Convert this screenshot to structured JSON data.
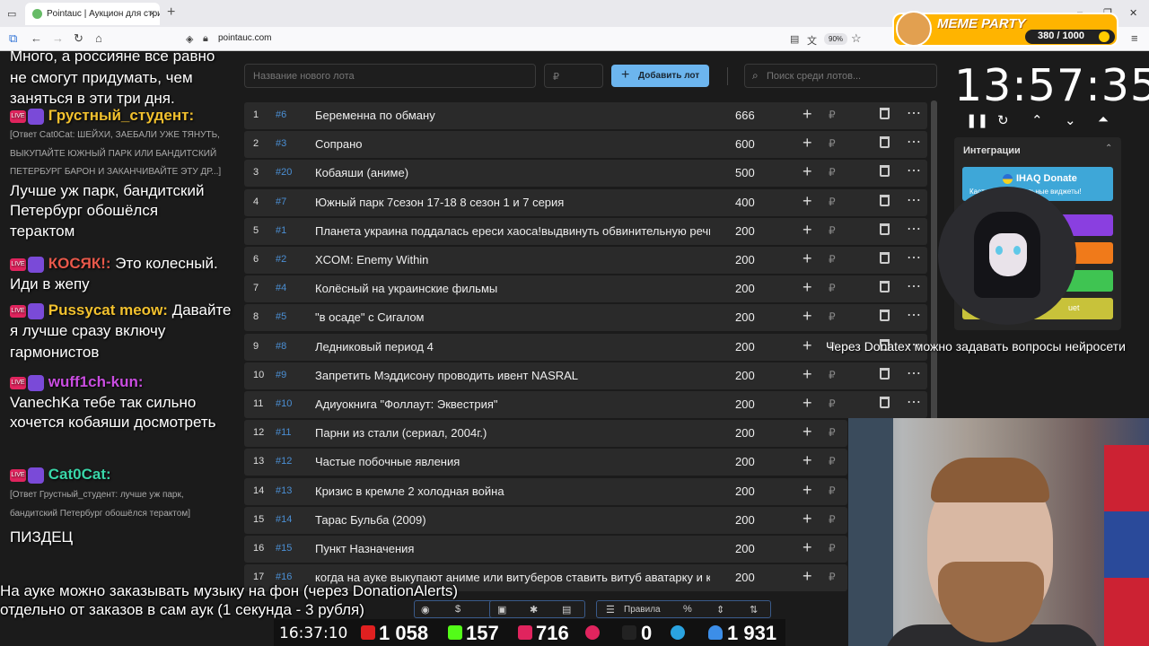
{
  "browser": {
    "tab_title": "Pointauc | Аукцион для стримеров",
    "url": "pointauc.com",
    "zoom": "90%"
  },
  "meme_party": {
    "title": "MEME PARTY",
    "count": "380 / 1000"
  },
  "chat": {
    "lines": [
      {
        "text": "Много, а россияне все равно"
      },
      {
        "text": "не смогут придумать, чем"
      },
      {
        "text": "заняться в эти три дня."
      },
      {
        "user": "Грустный_студент:",
        "color": "#f2c12e"
      },
      {
        "reply": "[Ответ Cat0Cat: ШЕЙХИ, ЗАЕБАЛИ УЖЕ ТЯНУТЬ,"
      },
      {
        "reply": "ВЫКУПАЙТЕ ЮЖНЫЙ ПАРК ИЛИ БАНДИТСКИЙ"
      },
      {
        "reply": "ПЕТЕРБУРГ БАРОН И ЗАКАНЧИВАЙТЕ ЭТУ ДР...]"
      },
      {
        "text": "Лучше уж парк, бандитский"
      },
      {
        "text": "Петербург обошёлся"
      },
      {
        "text": "терактом"
      },
      {
        "user": "КОСЯК!:",
        "color": "#e8584a",
        "msg": "Это колесный."
      },
      {
        "text": "Иди в жепу"
      },
      {
        "user": "Pussycat meow:",
        "color": "#f2c12e",
        "msg": "Давайте"
      },
      {
        "text": "я лучше сразу включу"
      },
      {
        "text": "гармонистов"
      },
      {
        "user": "wuff1ch-kun:",
        "color": "#c94de0"
      },
      {
        "text": "VanechKa тебе так сильно"
      },
      {
        "text": "хочется кобаяши досмотреть"
      },
      {
        "user": "Cat0Cat:",
        "color": "#39d6a8"
      },
      {
        "reply": "[Ответ Грустный_студент: лучше уж парк,"
      },
      {
        "reply": "бандитский Петербург обошёлся терактом]"
      },
      {
        "text": "ПИЗДЕЦ"
      }
    ]
  },
  "auction": {
    "lot_name_placeholder": "Название нового лота",
    "price_placeholder": "₽",
    "add_lot_label": "Добавить лот",
    "search_placeholder": "Поиск среди лотов...",
    "currency": "₽",
    "lots": [
      {
        "n": "1",
        "id": "#6",
        "name": "Беременна по обману",
        "amount": "666"
      },
      {
        "n": "2",
        "id": "#3",
        "name": "Сопрано",
        "amount": "600"
      },
      {
        "n": "3",
        "id": "#20",
        "name": "Кобаяши (аниме)",
        "amount": "500"
      },
      {
        "n": "4",
        "id": "#7",
        "name": "Южный парк 7сезон 17-18 8 сезон 1 и 7 серия",
        "amount": "400"
      },
      {
        "n": "5",
        "id": "#1",
        "name": "Планета украина поддалась ереси хаоса!выдвинуть обвинительную речь! по",
        "amount": "200"
      },
      {
        "n": "6",
        "id": "#2",
        "name": "XCOM: Enemy Within",
        "amount": "200"
      },
      {
        "n": "7",
        "id": "#4",
        "name": "Колёсный на украинские фильмы",
        "amount": "200"
      },
      {
        "n": "8",
        "id": "#5",
        "name": "\"в осаде\" с Сигалом",
        "amount": "200"
      },
      {
        "n": "9",
        "id": "#8",
        "name": "Ледниковый период 4",
        "amount": "200"
      },
      {
        "n": "10",
        "id": "#9",
        "name": "Запретить Мэддисону проводить ивент NASRAL",
        "amount": "200"
      },
      {
        "n": "11",
        "id": "#10",
        "name": "Адиуокнига \"Фоллаут: Эквестрия\"",
        "amount": "200"
      },
      {
        "n": "12",
        "id": "#11",
        "name": "Парни из стали (сериал, 2004г.)",
        "amount": "200"
      },
      {
        "n": "13",
        "id": "#12",
        "name": "Частые побочные явления",
        "amount": "200"
      },
      {
        "n": "14",
        "id": "#13",
        "name": "Кризис в кремле 2 холодная война",
        "amount": "200"
      },
      {
        "n": "15",
        "id": "#14",
        "name": "Тарас Бульба (2009)",
        "amount": "200"
      },
      {
        "n": "16",
        "id": "#15",
        "name": "Пункт Назначения",
        "amount": "200"
      },
      {
        "n": "17",
        "id": "#16",
        "name": "когда на ауке выкупают аниме или витуберов ставить витуб аватарку и крич",
        "amount": "200"
      }
    ]
  },
  "toolbar": {
    "rules_label": "Правила",
    "percent_label": "%",
    "dollar_label": "$"
  },
  "timer": {
    "time": "13:57:35"
  },
  "integrations": {
    "title": "Интеграции",
    "ihaq_label": "IHAQ Donate",
    "ihaq_sub": "Кастомные уникальные виджеты!",
    "last_btn_label": "uet",
    "colors": [
      "#8a3fe0",
      "#f07a1a",
      "#3fc452",
      "#c8c23a"
    ]
  },
  "overlay": {
    "donatex_text": "Через Donatex можно задавать вопросы нейросети",
    "caption_1": "На ауке можно заказывать музыку на фон (через DonationAlerts)",
    "caption_2": "отдельно от заказов в сам аук (1 секунда - 3 рубля)"
  },
  "stats": {
    "time": "16:37:10",
    "youtube": "1 058",
    "kick": "157",
    "vk": "716",
    "rutube": "0",
    "telegram": "",
    "viewers": "1 931"
  }
}
